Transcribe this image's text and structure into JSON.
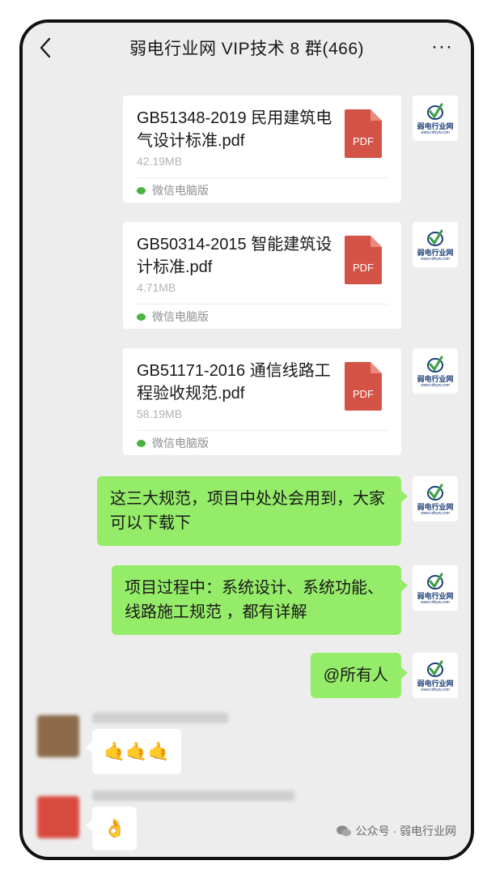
{
  "header": {
    "title": "弱电行业网 VIP技术 8 群(466)",
    "back_icon": "chevron-left-icon",
    "more_label": "···"
  },
  "avatar": {
    "name": "弱电行业网",
    "url": "www.rdhyw.com",
    "accent": "#1d3f7a",
    "check_color": "#3aa041"
  },
  "files": [
    {
      "name": "GB51348-2019 民用建筑电气设计标准.pdf",
      "size": "42.19MB",
      "source": "微信电脑版",
      "badge": "PDF"
    },
    {
      "name": "GB50314-2015 智能建筑设计标准.pdf",
      "size": "4.71MB",
      "source": "微信电脑版",
      "badge": "PDF"
    },
    {
      "name": "GB51171-2016 通信线路工程验收规范.pdf",
      "size": "58.19MB",
      "source": "微信电脑版",
      "badge": "PDF"
    }
  ],
  "messages": [
    {
      "text": "这三大规范，项目中处处会用到，大家可以下载下"
    },
    {
      "text": "项目过程中：系统设计、系统功能、线路施工规范 ，都有详解"
    },
    {
      "text": "@所有人"
    }
  ],
  "replies": [
    {
      "content": "🤙🤙🤙",
      "avatar_color": "#8c6a4a"
    },
    {
      "content": "👌",
      "avatar_color": "#d84a3e"
    }
  ],
  "watermark": {
    "text": "公众号 · 弱电行业网"
  },
  "colors": {
    "bubble": "#95ec69",
    "background": "#ededed",
    "pdf": "#d35446"
  }
}
